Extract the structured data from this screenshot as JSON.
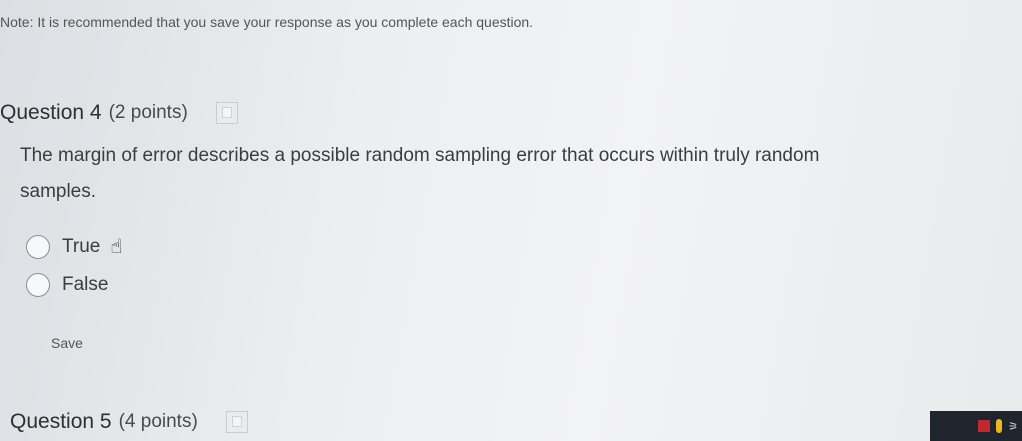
{
  "note": "Note: It is recommended that you save your response as you complete each question.",
  "question4": {
    "title": "Question 4",
    "points": "(2 points)",
    "text": "The margin of error describes a possible random sampling error that occurs within truly random samples.",
    "options": [
      {
        "label": "True"
      },
      {
        "label": "False"
      }
    ],
    "save_label": "Save"
  },
  "question5": {
    "title": "Question 5",
    "points": "(4 points)"
  },
  "icons": {
    "save_question": "floppy-disk-icon",
    "cursor": "hand-pointer-icon",
    "tray": [
      "pdf-icon",
      "user-icon",
      "network-icon"
    ]
  }
}
